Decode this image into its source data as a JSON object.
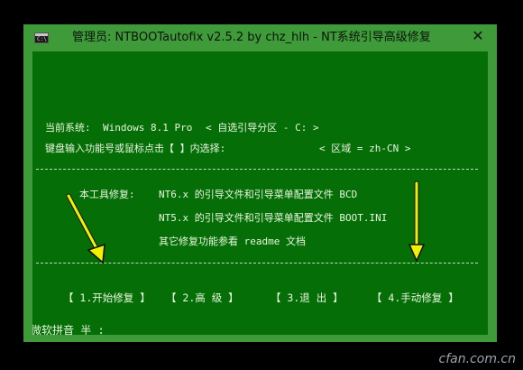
{
  "window": {
    "title": "管理员:  NTBOOTautofix v2.5.2 by chz_hlh - NT系统引导高级修复",
    "icon_text": "C:\\",
    "close_label": "✕"
  },
  "console": {
    "current_system_label": "当前系统:",
    "current_system_value": "Windows 8.1 Pro",
    "self_select": "< 自选引导分区 - C: >",
    "prompt": "键盘输入功能号或鼠标点击【 】内选择:",
    "region": "< 区域 = zh-CN >",
    "repair_label": "本工具修复:",
    "repair_line1": "NT6.x 的引导文件和引导菜单配置文件 BCD",
    "repair_line2": "NT5.x 的引导文件和引导菜单配置文件 BOOT.INI",
    "repair_line3": "其它修复功能参看 readme 文档",
    "menu": {
      "start": "【 1.开始修复 】",
      "advanced": "【 2.高  级 】",
      "exit": "【 3.退  出 】",
      "manual": "【 4.手动修复 】"
    },
    "ime_status": "微软拼音 半 :"
  },
  "watermark": "cfan.com.cn",
  "colors": {
    "console_bg": "#066e06",
    "window_frame": "#3f9a3a",
    "arrow": "#f2f200"
  }
}
